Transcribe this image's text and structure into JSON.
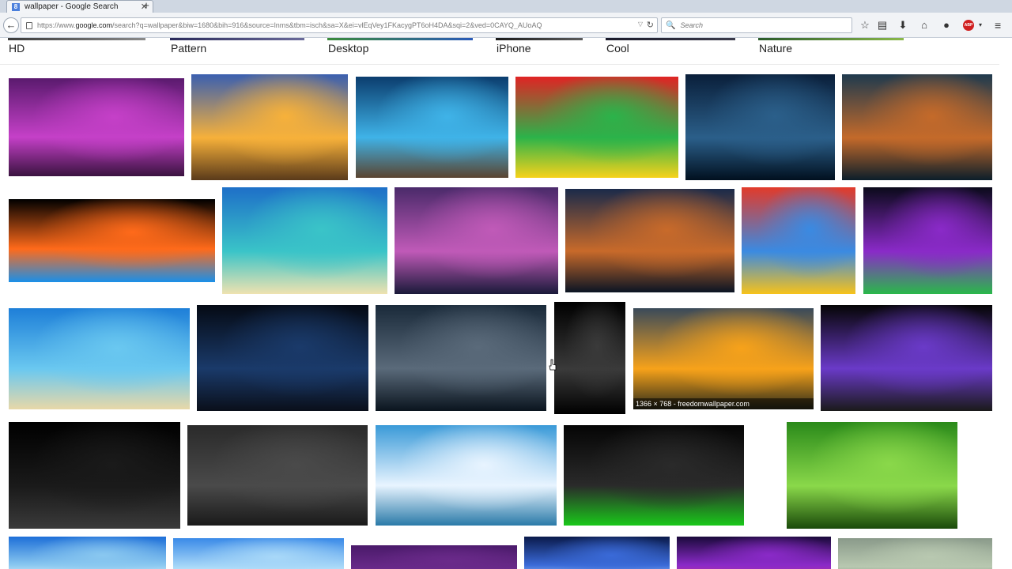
{
  "browser": {
    "tab_title": "wallpaper - Google Search",
    "tab_favicon": "8",
    "newtab_label": "+",
    "url_prefix": "https://www.",
    "url_domain": "google.com",
    "url_rest": "/search?q=wallpaper&biw=1680&bih=916&source=lnms&tbm=isch&sa=X&ei=vlEqVey1FKacygPT6oH4DA&sqi=2&ved=0CAYQ_AUoAQ",
    "search_placeholder": "Search",
    "abp_label": "ABP"
  },
  "chips": [
    "HD",
    "Pattern",
    "Desktop",
    "iPhone",
    "Cool",
    "Nature"
  ],
  "images": [
    {
      "name": "image-purple-bridge",
      "colors": [
        "#5a1a6e",
        "#c540c8",
        "#3a1340"
      ]
    },
    {
      "name": "image-eiffel-tower",
      "colors": [
        "#3a5fb0",
        "#f7b13a",
        "#5a3a1a"
      ]
    },
    {
      "name": "image-blue-bokeh",
      "colors": [
        "#0b3d6e",
        "#3fb3e8",
        "#5a4430"
      ]
    },
    {
      "name": "image-rainbow-swirl",
      "colors": [
        "#e02424",
        "#2bb34a",
        "#f7d21a"
      ]
    },
    {
      "name": "image-ship-moon",
      "colors": [
        "#0a1f3a",
        "#2b5f8a",
        "#01101f"
      ]
    },
    {
      "name": "image-rainy-window",
      "colors": [
        "#1f3a4e",
        "#c46a2a",
        "#0b1e2a"
      ]
    },
    {
      "name": "image-fire-ice-fists",
      "colors": [
        "#000000",
        "#ff6a1a",
        "#1a8fe8"
      ]
    },
    {
      "name": "image-tropical-beach",
      "colors": [
        "#1e6fc8",
        "#3ac4c8",
        "#efe2b0"
      ]
    },
    {
      "name": "image-cracked-apple",
      "colors": [
        "#4a2a6a",
        "#c05ab8",
        "#1a1a3a"
      ]
    },
    {
      "name": "image-golden-gate",
      "colors": [
        "#1a2a4a",
        "#c86a2a",
        "#0a1424"
      ]
    },
    {
      "name": "image-color-blocks",
      "colors": [
        "#e23a2a",
        "#3a8ae2",
        "#f7c21a"
      ]
    },
    {
      "name": "image-eclipse-trees",
      "colors": [
        "#0a0a1a",
        "#8a2ac8",
        "#2ab84a"
      ]
    },
    {
      "name": "image-ocean-waves",
      "colors": [
        "#1e7fd8",
        "#6ac8f0",
        "#e8d8a8"
      ]
    },
    {
      "name": "image-world-map-blue",
      "colors": [
        "#050a14",
        "#1a3a6a",
        "#0a0f1a"
      ]
    },
    {
      "name": "image-gray-cat",
      "colors": [
        "#1a2a3a",
        "#5a6a7a",
        "#0a141e"
      ]
    },
    {
      "name": "image-batman",
      "colors": [
        "#000000",
        "#3a3a3a",
        "#000000"
      ]
    },
    {
      "name": "image-sunset-clouds",
      "colors": [
        "#3a4a5a",
        "#f7a21a",
        "#2a2a1a"
      ]
    },
    {
      "name": "image-apple-rainbow",
      "colors": [
        "#050505",
        "#6a3ac8",
        "#1a1a1a"
      ]
    },
    {
      "name": "image-dark-car",
      "colors": [
        "#000000",
        "#1a1a1a",
        "#3a3a3a"
      ]
    },
    {
      "name": "image-world-map-gray",
      "colors": [
        "#2a2a2a",
        "#4a4a4a",
        "#1a1a1a"
      ]
    },
    {
      "name": "image-clouds-sea",
      "colors": [
        "#3a9ad8",
        "#e8f4ff",
        "#2a7aa8"
      ]
    },
    {
      "name": "image-muscle-cars",
      "colors": [
        "#050505",
        "#2a2a2a",
        "#1ac81a"
      ]
    },
    {
      "name": "image-ladybugs",
      "colors": [
        "#2a8a1a",
        "#8ad84a",
        "#1a4a0a"
      ]
    },
    {
      "name": "image-blue-sky",
      "colors": [
        "#1e6fd8",
        "#8ac8f0",
        "#ffffff"
      ]
    },
    {
      "name": "image-sky-light",
      "colors": [
        "#3a8ae8",
        "#a8d8f8",
        "#ffffff"
      ]
    },
    {
      "name": "image-purple-pattern",
      "colors": [
        "#4a1a6a",
        "#6a2a8a",
        "#3a0a5a"
      ]
    },
    {
      "name": "image-moon-night",
      "colors": [
        "#0a1a4a",
        "#3a6ad8",
        "#c8e8ff"
      ]
    },
    {
      "name": "image-purple-bokeh",
      "colors": [
        "#1a0a3a",
        "#8a2ac8",
        "#d83a8a"
      ]
    },
    {
      "name": "image-gray-texture",
      "colors": [
        "#8a9a8a",
        "#b8c8b0",
        "#6a7a6a"
      ]
    }
  ],
  "caption": "1366 × 768 - freedomwallpaper.com"
}
